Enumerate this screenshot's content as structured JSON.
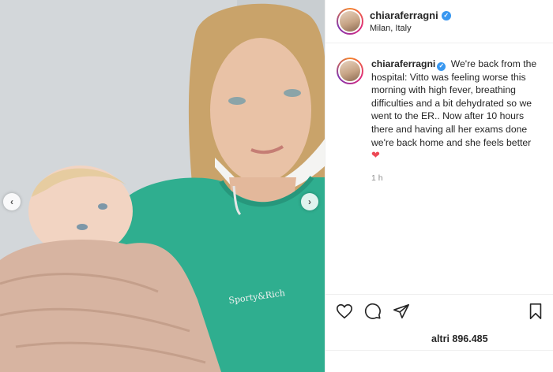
{
  "post": {
    "photo_alt": "",
    "carousel": {
      "prev_icon": "chevron-left-icon",
      "next_icon": "chevron-right-icon"
    }
  },
  "header": {
    "username": "chiaraferragni",
    "verified_icon": "verified-badge-icon",
    "location": "Milan, Italy"
  },
  "caption": {
    "username": "chiaraferragni",
    "text": "We're back from the hospital: Vitto was feeling worse this morning with high fever, breathing difficulties and a bit dehydrated so we went to the ER.. Now after 10 hours there and having all her exams done we're back home and she feels better",
    "emoji": "❤",
    "time": "1 h"
  },
  "actions": {
    "like_icon": "heart-outline-icon",
    "comment_icon": "comment-icon",
    "share_icon": "paper-plane-icon",
    "save_icon": "bookmark-icon"
  },
  "likes": {
    "text": "altri 896.485"
  },
  "comment_box": {
    "placeholder": ""
  },
  "colors": {
    "verified": "#3897f0",
    "heart": "#ed4956",
    "top_green": "#2fae8f"
  }
}
